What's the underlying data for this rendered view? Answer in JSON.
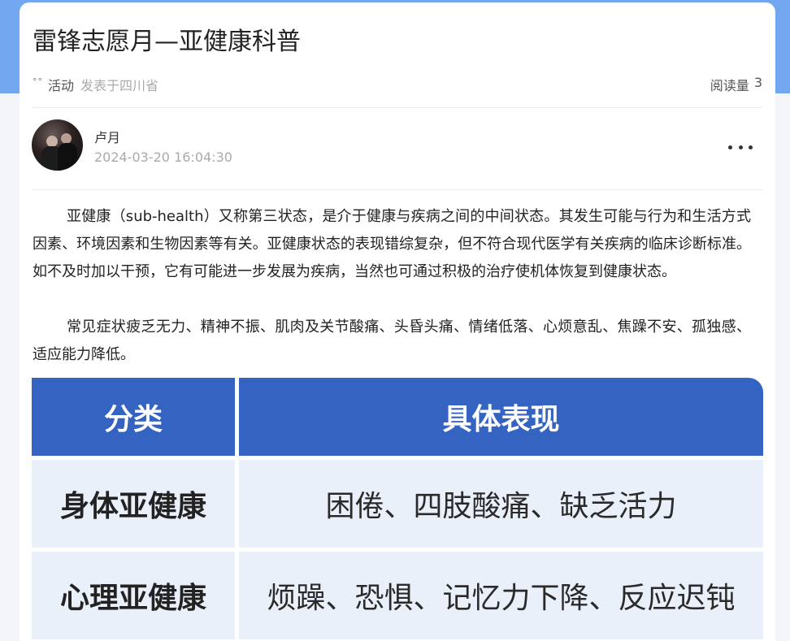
{
  "post": {
    "title": "雷锋志愿月—亚健康科普",
    "category_icon": "dots-icon",
    "category": "活动",
    "posted_from": "发表于四川省",
    "read_label": "阅读量",
    "read_count": "3"
  },
  "author": {
    "name": "卢月",
    "time": "2024-03-20 16:04:30",
    "more_icon": "more-horizontal-icon"
  },
  "content": {
    "paragraphs": [
      "亚健康（sub-health）又称第三状态，是介于健康与疾病之间的中间状态。其发生可能与行为和生活方式因素、环境因素和生物因素等有关。亚健康状态的表现错综复杂，但不符合现代医学有关疾病的临床诊断标准。如不及时加以干预，它有可能进一步发展为疾病，当然也可通过积极的治疗使机体恢复到健康状态。",
      "常见症状疲乏无力、精神不振、肌肉及关节酸痛、头昏头痛、情绪低落、心烦意乱、焦躁不安、孤独感、适应能力降低。"
    ]
  },
  "table": {
    "headers": [
      "分类",
      "具体表现"
    ],
    "rows": [
      [
        "身体亚健康",
        "困倦、四肢酸痛、缺乏活力"
      ],
      [
        "心理亚健康",
        "烦躁、恐惧、记忆力下降、反应迟钝"
      ]
    ]
  },
  "colors": {
    "header_band": "#72a6ee",
    "table_header": "#3463c2",
    "table_cell": "#eaf0fa"
  }
}
